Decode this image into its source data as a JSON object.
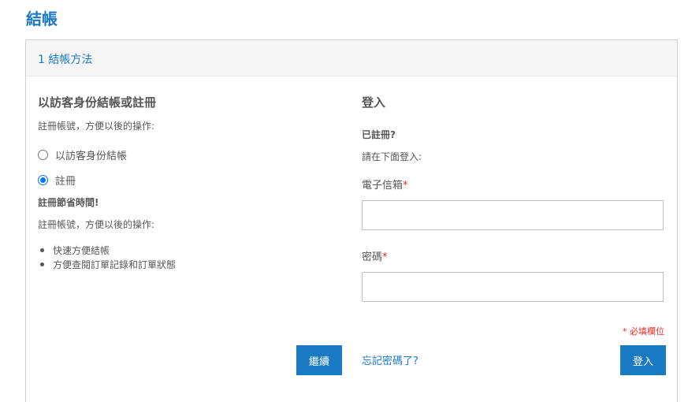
{
  "page": {
    "title": "結帳"
  },
  "step": {
    "header": "1 結帳方法"
  },
  "guest_section": {
    "title": "以訪客身份結帳或註冊",
    "subtitle": "註冊帳號，方便以後的操作:",
    "options": [
      {
        "label": "以訪客身份結帳",
        "checked": false
      },
      {
        "label": "註冊",
        "checked": true
      }
    ],
    "note_title": "註冊節省時間!",
    "note_text": "註冊帳號，方便以後的操作:",
    "benefits": [
      "快速方便結帳",
      "方便查閱訂單記錄和訂單狀態"
    ],
    "continue_label": "繼續"
  },
  "login_section": {
    "title": "登入",
    "registered_title": "已註冊?",
    "registered_text": "請在下面登入:",
    "email_label": "電子信箱",
    "email_value": "",
    "password_label": "密碼",
    "password_value": "",
    "required_marker": "*",
    "required_note": "* 必填欄位",
    "forgot_label": "忘記密碼了?",
    "login_label": "登入"
  },
  "colors": {
    "accent": "#1979c3",
    "required": "#e02b27",
    "header_bg": "#f6f6f6"
  }
}
